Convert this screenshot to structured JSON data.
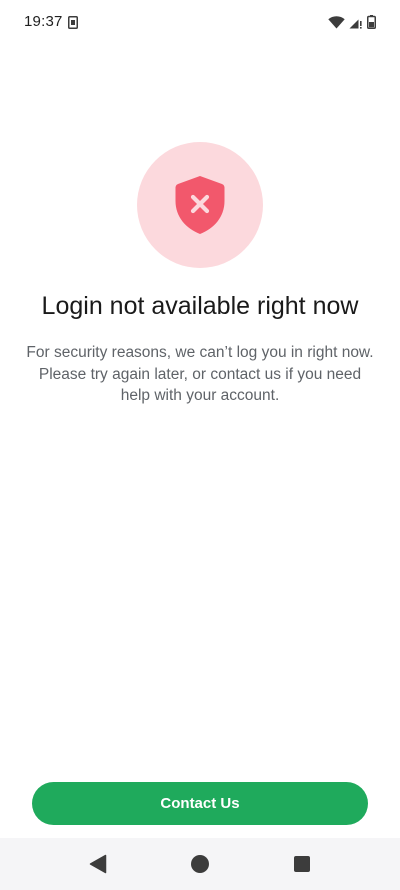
{
  "status_bar": {
    "time": "19:37",
    "icons": [
      "sim-card-icon",
      "wifi-icon",
      "cellular-signal-icon",
      "battery-icon"
    ]
  },
  "main": {
    "icon": "shield-error-icon",
    "title": "Login not available right now",
    "message": "For security reasons, we can’t log you in right now. Please try again later, or contact us if you need help with your account."
  },
  "actions": {
    "contact_label": "Contact Us"
  },
  "navigation": {
    "icons": [
      "back-icon",
      "home-icon",
      "recents-icon"
    ]
  },
  "colors": {
    "accent": "#1faa5c",
    "shield": "#f2586c",
    "shield_bg": "#fcd9dd",
    "text_primary": "#1a1a1a",
    "text_secondary": "#5f6368"
  }
}
